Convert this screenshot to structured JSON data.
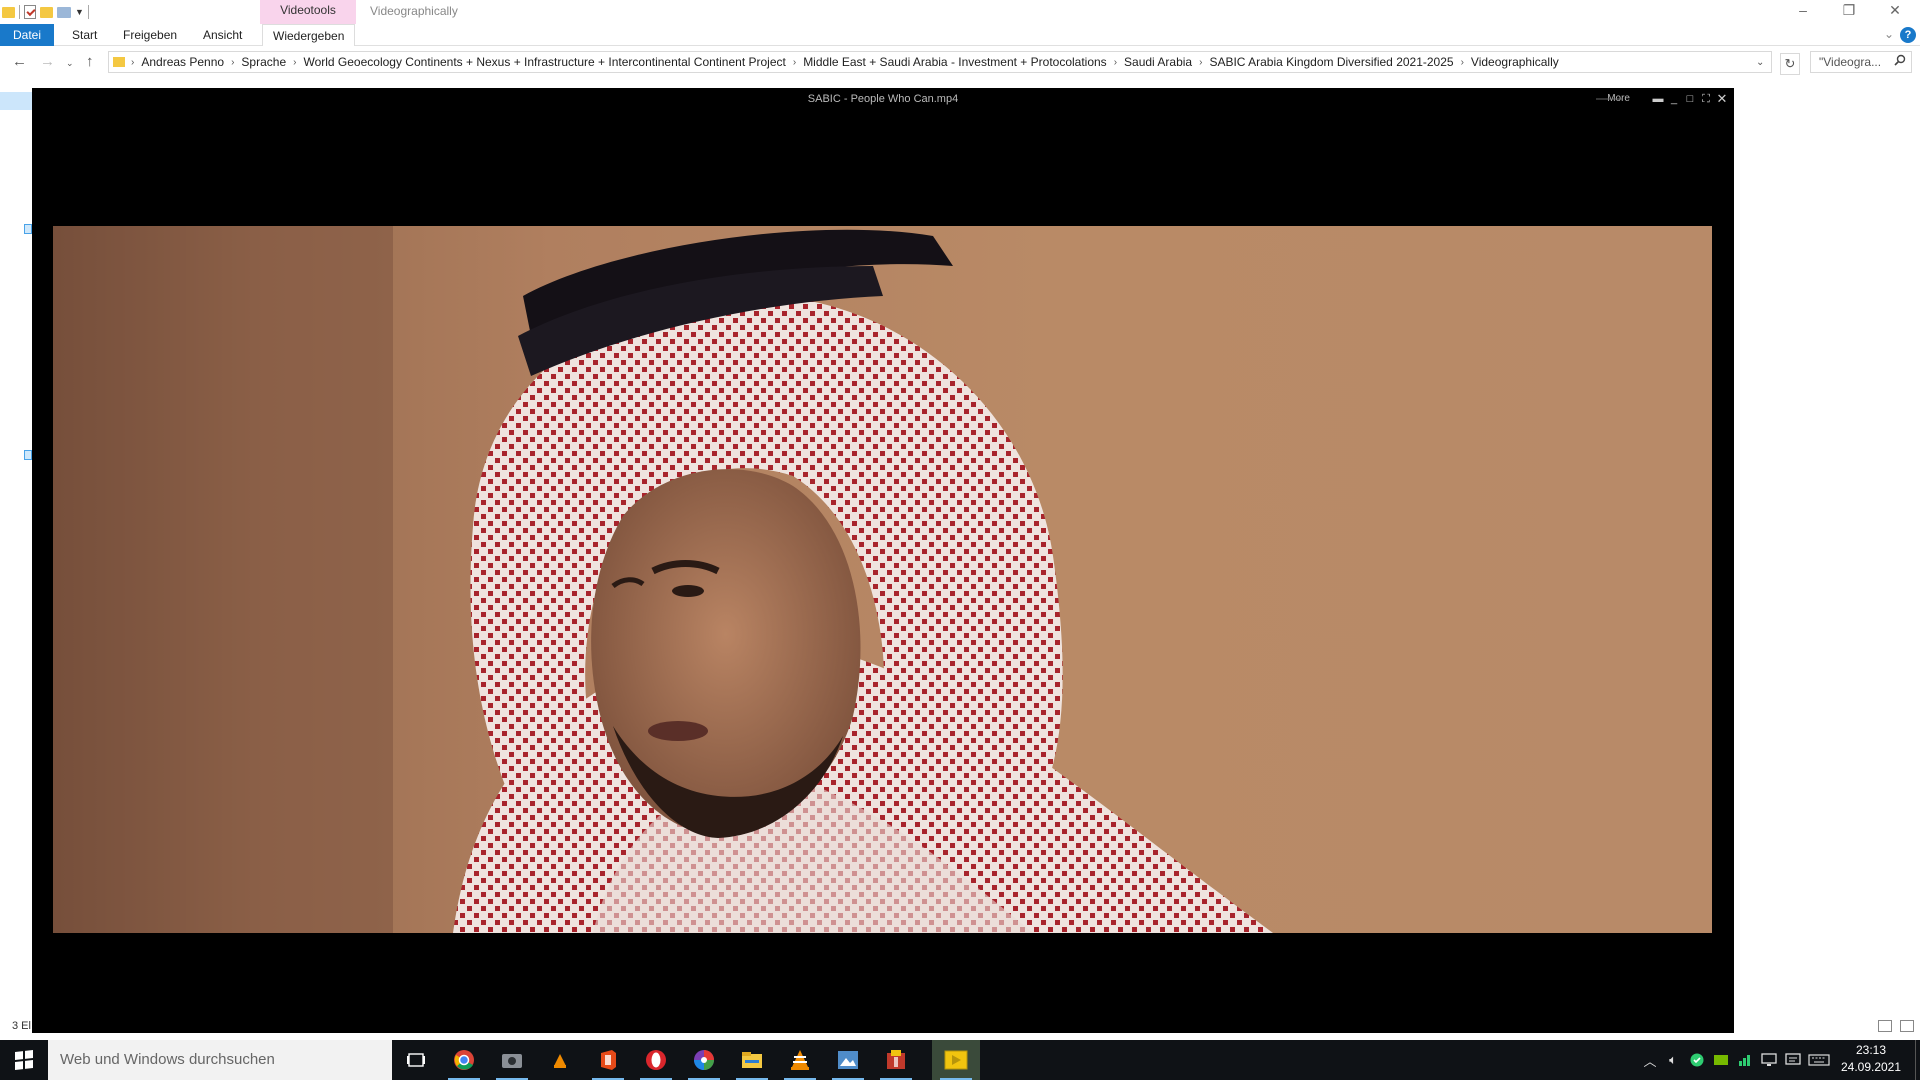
{
  "window": {
    "contextual_tab": "Videotools",
    "title": "Videographically"
  },
  "ribbon": {
    "tabs": [
      {
        "label": "Datei"
      },
      {
        "label": "Start"
      },
      {
        "label": "Freigeben"
      },
      {
        "label": "Ansicht"
      },
      {
        "label": "Wiedergeben"
      }
    ],
    "help": "?"
  },
  "address": {
    "breadcrumbs": [
      "Andreas Penno",
      "Sprache",
      "World Geoecology Continents + Nexus + Infrastructure + Intercontinental Continent Project",
      "Middle East + Saudi Arabia - Investment + Protocolations",
      "Saudi Arabia",
      "SABIC Arabia Kingdom Diversified 2021-2025",
      "Videographically"
    ],
    "search_placeholder": "\"Videogra..."
  },
  "statusbar": {
    "item_count": "3 El"
  },
  "player": {
    "title": "SABIC  - People Who Can.mp4",
    "more_label": "More"
  },
  "taskbar": {
    "search_placeholder": "Web und Windows durchsuchen",
    "apps": [
      {
        "icon": "task-view-icon"
      },
      {
        "icon": "chrome-icon"
      },
      {
        "icon": "camera-app-icon"
      },
      {
        "icon": "vlc-small-icon"
      },
      {
        "icon": "office-icon"
      },
      {
        "icon": "opera-icon"
      },
      {
        "icon": "picasa-icon"
      },
      {
        "icon": "file-explorer-icon"
      },
      {
        "icon": "vlc-icon"
      },
      {
        "icon": "photo-viewer-icon"
      },
      {
        "icon": "package-icon"
      },
      {
        "icon": "media-player-icon"
      }
    ],
    "time": "23:13",
    "date": "24.09.2021"
  }
}
